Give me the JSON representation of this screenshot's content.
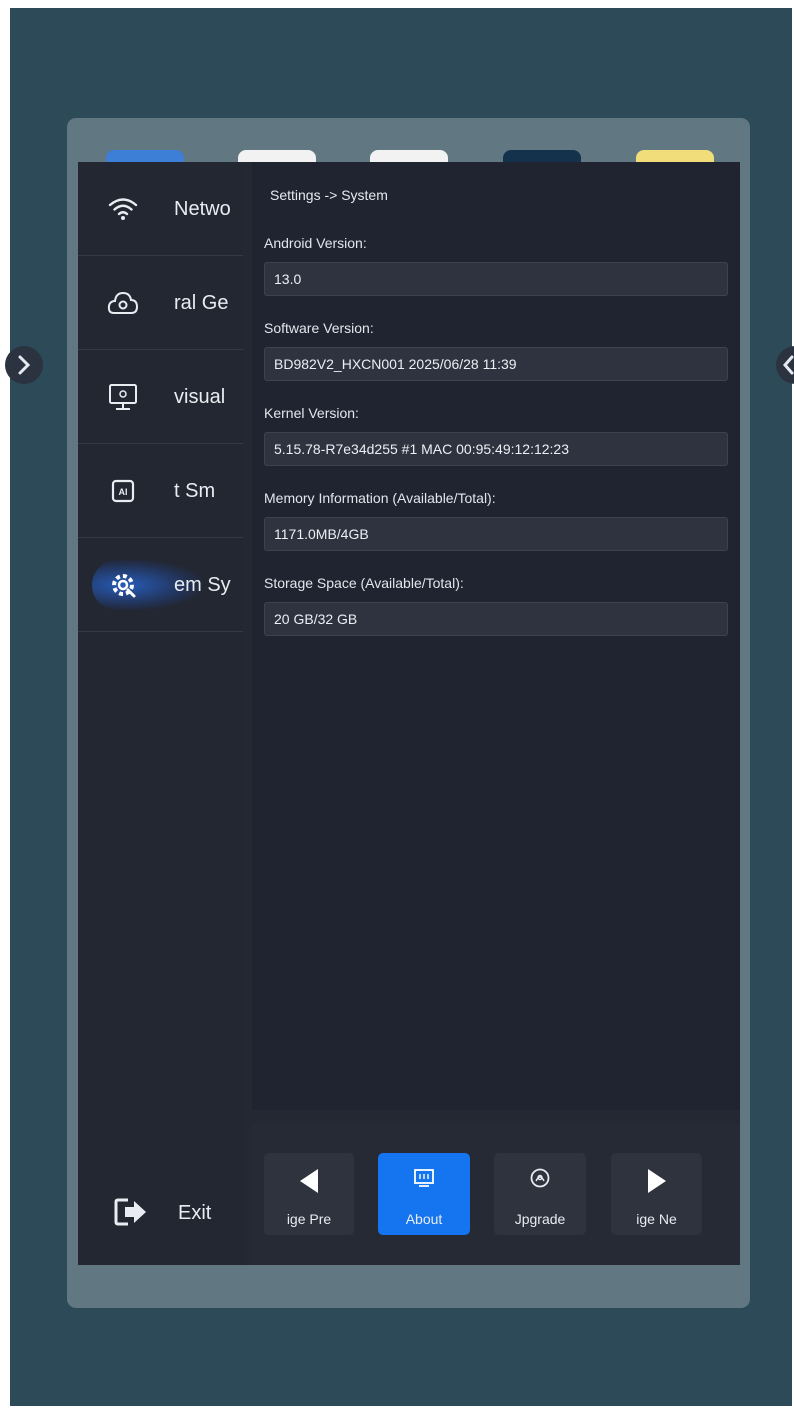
{
  "sidebar": {
    "items": [
      {
        "label": "Netwo",
        "icon": "wifi-icon"
      },
      {
        "label": "ral  Ge",
        "icon": "cloud-settings-icon"
      },
      {
        "label": "visual",
        "icon": "monitor-icon"
      },
      {
        "label": "t  Sm",
        "icon": "ai-chip-icon"
      },
      {
        "label": "em  Sy",
        "icon": "gear-icon",
        "active": true
      }
    ],
    "exit": {
      "label": "Exit",
      "icon": "exit-icon"
    }
  },
  "content": {
    "breadcrumb": "Settings -> System",
    "fields": [
      {
        "label": "Android Version:",
        "value": "13.0"
      },
      {
        "label": "Software Version:",
        "value": "BD982V2_HXCN001 2025/06/28 11:39"
      },
      {
        "label": "Kernel Version:",
        "value": "5.15.78-R7e34d255 #1 MAC 00:95:49:12:12:23"
      },
      {
        "label": "Memory Information (Available/Total):",
        "value": "1171.0MB/4GB"
      },
      {
        "label": "Storage Space (Available/Total):",
        "value": "20 GB/32 GB"
      }
    ]
  },
  "bottombar": {
    "prev_label": "ige   Pre",
    "about_label": "About",
    "upgrade_label": "Jpgrade",
    "next_label": "ige   Ne"
  },
  "colors": {
    "accent": "#1574ef",
    "background": "#2d4a58",
    "panel": "#617782",
    "content": "#202430"
  }
}
